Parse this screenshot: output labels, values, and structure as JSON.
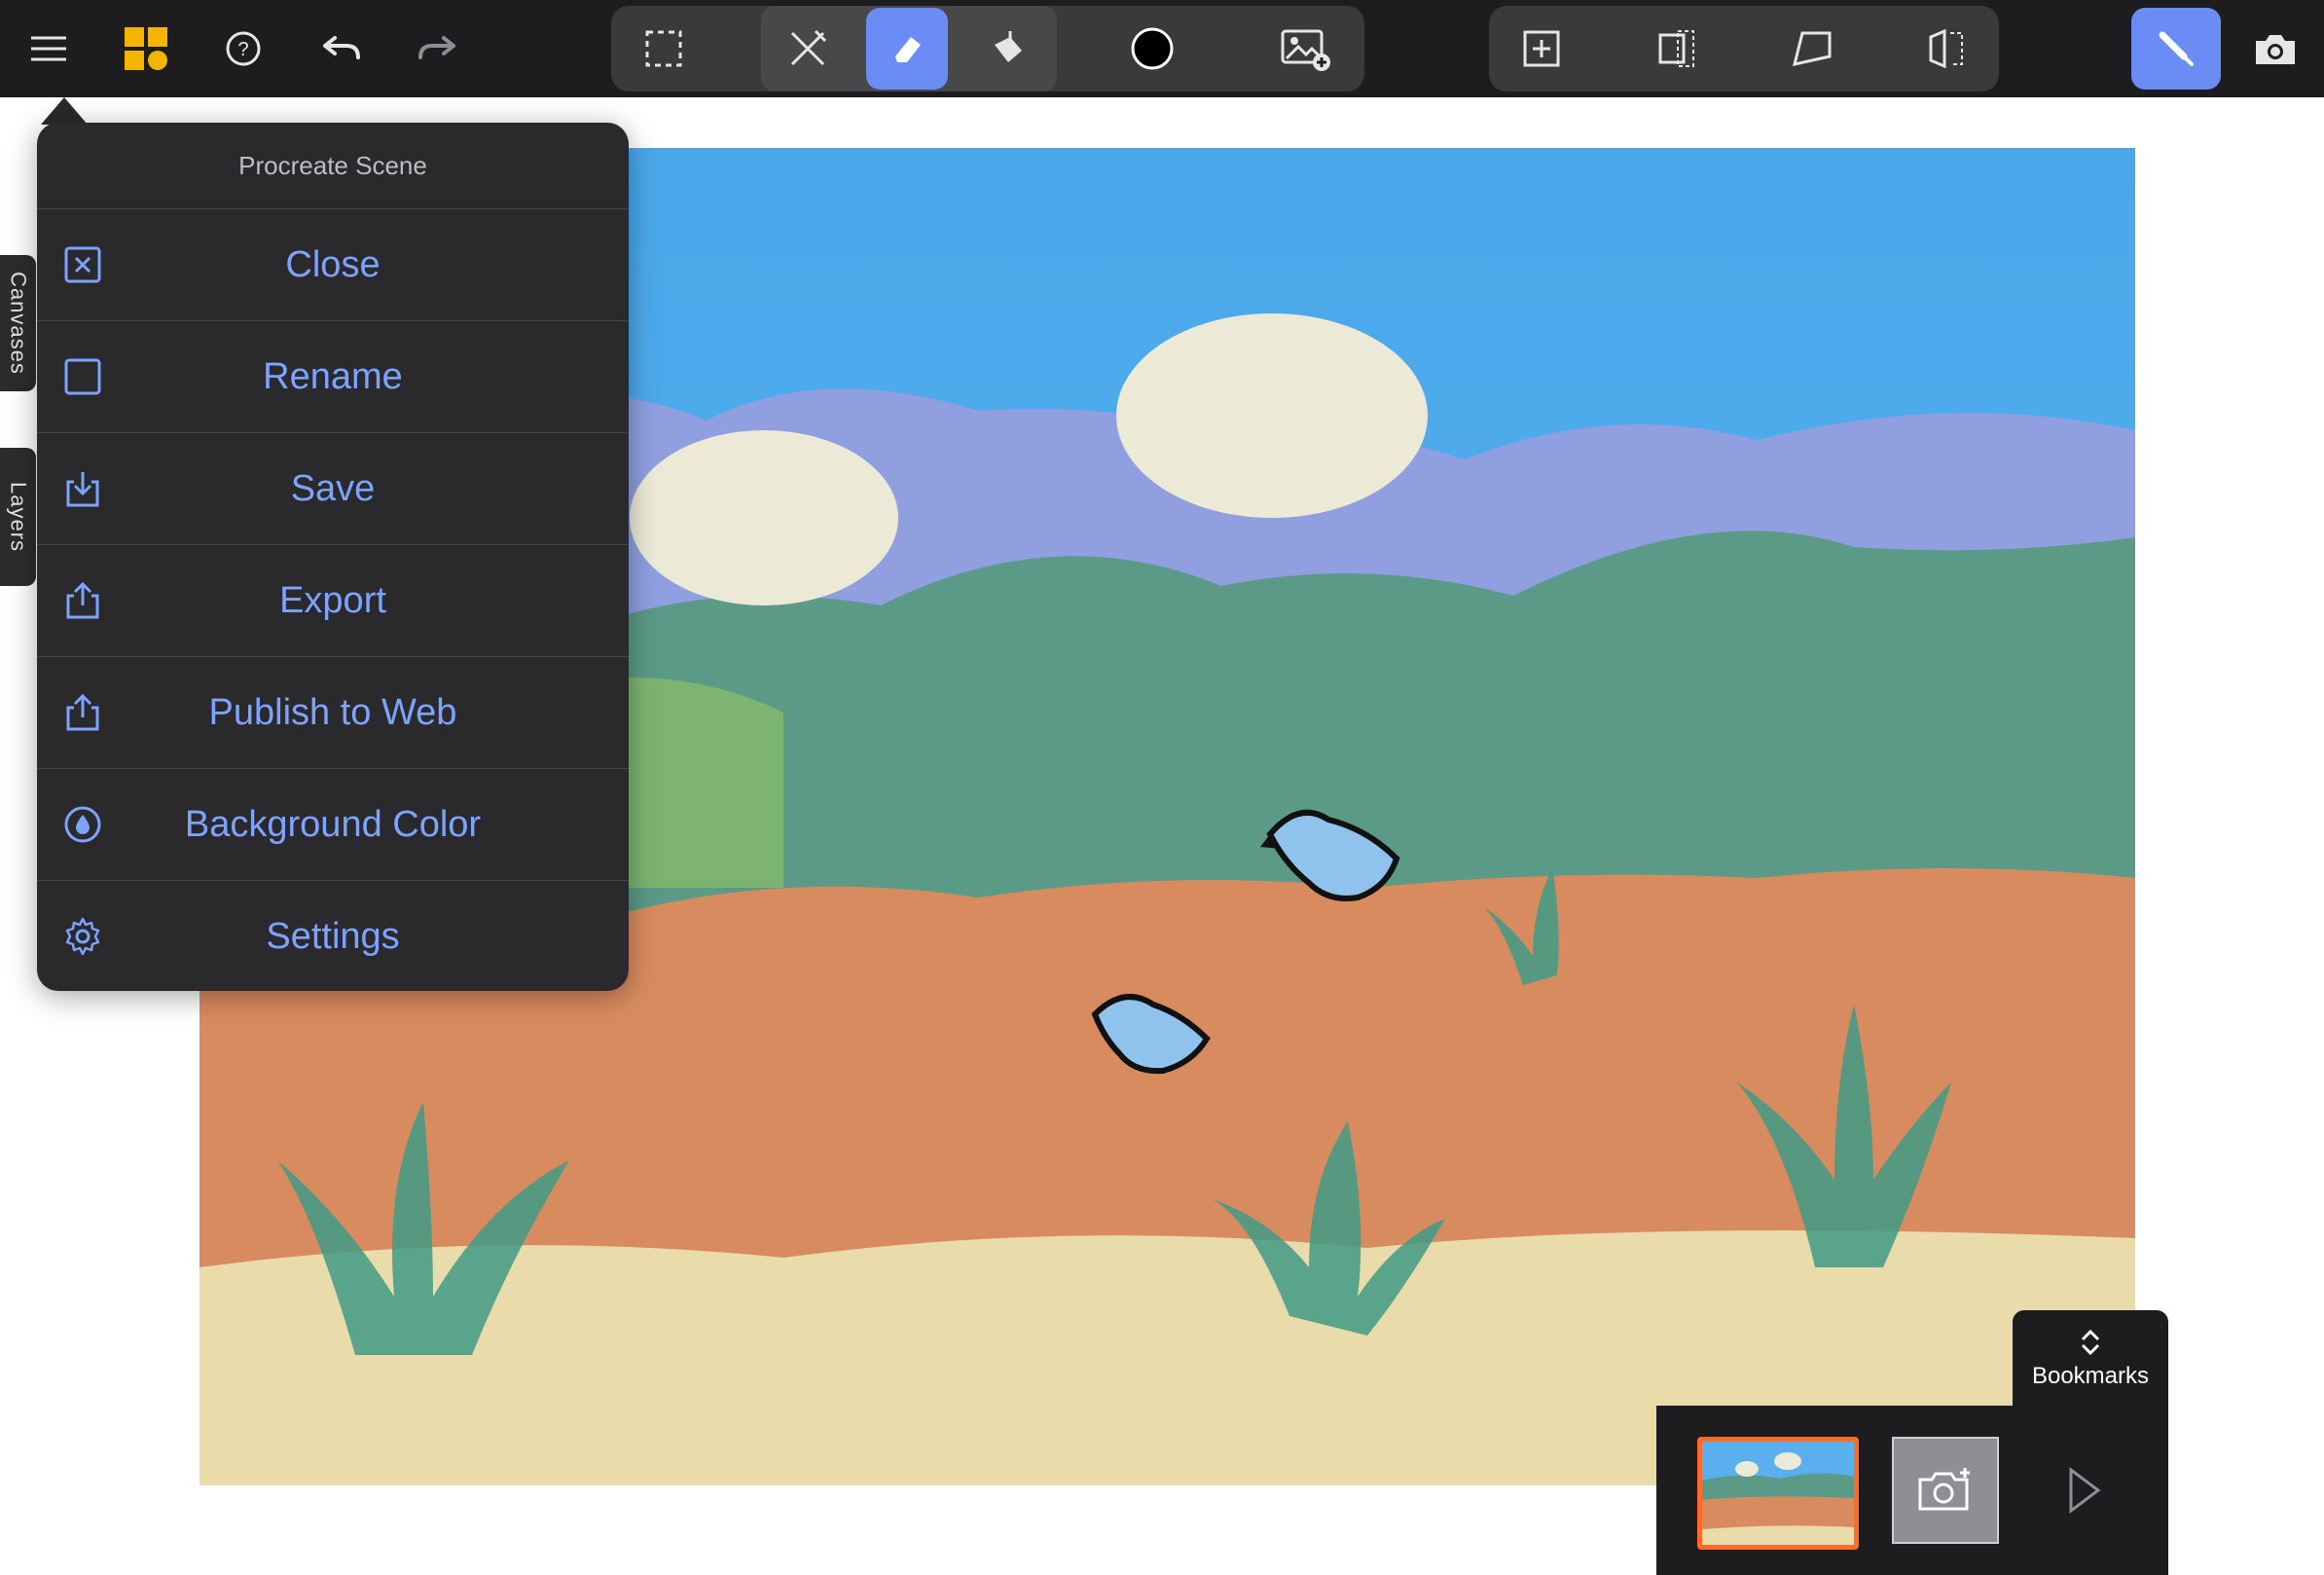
{
  "menu": {
    "title": "Procreate Scene",
    "items": [
      {
        "label": "Close",
        "icon": "close-square-icon"
      },
      {
        "label": "Rename",
        "icon": "square-icon"
      },
      {
        "label": "Save",
        "icon": "save-icon"
      },
      {
        "label": "Export",
        "icon": "export-icon"
      },
      {
        "label": "Publish to Web",
        "icon": "publish-icon"
      },
      {
        "label": "Background Color",
        "icon": "color-drop-icon"
      },
      {
        "label": "Settings",
        "icon": "gear-icon"
      }
    ]
  },
  "side_tabs": {
    "canvases": "Canvases",
    "layers": "Layers"
  },
  "bookmarks": {
    "label": "Bookmarks"
  },
  "colors": {
    "accent": "#7da2ff",
    "active_tool": "#6b8cf5",
    "toolbar": "#1d1d1f",
    "bookmark_selected": "#ff6b2b"
  },
  "toolbar_icons": [
    "hamburger-menu-icon",
    "app-logo",
    "help-icon",
    "undo-icon",
    "redo-icon",
    "selection-icon",
    "brush-tools-icon",
    "eraser-icon",
    "fill-icon",
    "color-swatch-icon",
    "add-image-icon",
    "add-frame-icon",
    "crop-icon",
    "perspective-icon",
    "flip-icon",
    "draw-mode-icon",
    "camera-icon"
  ]
}
